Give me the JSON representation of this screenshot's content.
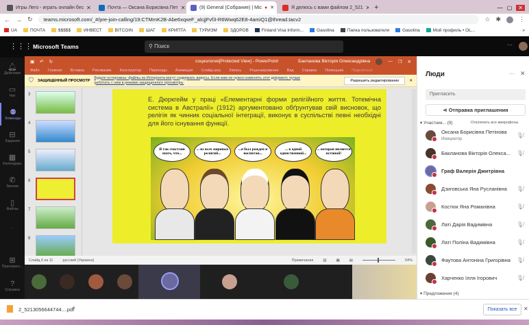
{
  "browser": {
    "tabs": [
      {
        "title": "Игры Лего - играть онлайн бес",
        "color": "#555"
      },
      {
        "title": "Почта — Оксана Борисівна Пет",
        "color": "#0f6cbd"
      },
      {
        "title": "(9) General (Собрание) | Mic",
        "color": "#5b5fc7"
      },
      {
        "title": "Я делюсь с вами файлом 2_521",
        "color": "#d93025"
      }
    ],
    "new_tab": "+",
    "url": "teams.microsoft.com/_#/pre-join-calling/19:CTMmK2B-Abe6xqxeF_alcjjFvf3-R6Wwq62E8-4amiQ1@thread.tacv2",
    "bookmarks": [
      "UA",
      "ПОЧТА",
      "$$$$$",
      "ИНВЕСТ",
      "BITCOIN",
      "ШАГ",
      "КРИПТА",
      "ТУРИЗМ",
      "ЗДОРОВ",
      "Finland Visa Inform...",
      "Gasolina",
      "Папка пользователя",
      "Gasolina",
      "Мой профиль • OL..."
    ],
    "more": "»"
  },
  "teams": {
    "app_name": "Microsoft Teams",
    "search_placeholder": "Поиск",
    "more": "···",
    "rail": [
      {
        "label": "Действия",
        "icon": "bell-icon",
        "badge": "3"
      },
      {
        "label": "Чат",
        "icon": "chat-icon",
        "badge": "6"
      },
      {
        "label": "Команды",
        "icon": "teams-icon",
        "active": true
      },
      {
        "label": "Задания",
        "icon": "assignments-icon"
      },
      {
        "label": "Календарь",
        "icon": "calendar-icon"
      },
      {
        "label": "Звонки",
        "icon": "phone-icon"
      },
      {
        "label": "Файлы",
        "icon": "file-icon"
      },
      {
        "label": "...",
        "icon": "more-icon"
      }
    ],
    "rail_bottom": [
      {
        "label": "Приложен...",
        "icon": "apps-icon"
      },
      {
        "label": "Справка",
        "icon": "help-icon"
      }
    ]
  },
  "ppt": {
    "title": "социология[Protected View] - PowerPoint",
    "user": "Бакланова Вікторія Олександрівна",
    "menu": [
      "Файл",
      "Главная",
      "Вставка",
      "Рисование",
      "Конструктор",
      "Переходы",
      "Анимация",
      "Слайд-шоу",
      "Запись",
      "Рецензирование",
      "Вид",
      "Справка",
      "Помощник",
      "Поделиться"
    ],
    "protected_label": "ЗАЩИЩЕННЫЙ ПРОСМОТР",
    "protected_msg": "Будьте осторожны: файлы из Интернета могут содержать вирусы. Если вам не нужно изменять этот документ, лучше работать с ним в режиме защищенного просмотра.",
    "enable_edit": "Разрешить редактирование",
    "thumb_numbers": [
      "3",
      "4",
      "5",
      "6",
      "7",
      "8"
    ],
    "slide_text": "Е. Дюркгейм у праці «Елементарні форми релігійного життя. Тотемічна система в Австралії» (1912) аргументовано обґрунтував свій висновок, що релігія як чинник соціальної інтеграції, виконує в суспільстві певні необхідні для його існування функції.",
    "bubbles": [
      "Я так счастлив знать, что...",
      "... из всех мировых религий...",
      "...я был рожден и воспитан...",
      "... в одной единственной...",
      "... которая является истиной!"
    ],
    "status": {
      "slide": "Слайд 6 из 11",
      "lang": "русский (Украина)",
      "notes": "Примечания",
      "zoom": "54%"
    }
  },
  "people": {
    "title": "Люди",
    "invite_placeholder": "Пригласить",
    "share_invite": "Отправка приглашения",
    "participants_label": "Участник... (9)",
    "mute_all": "Отключить все микрофоны",
    "participants": [
      {
        "name": "Оксана Борисівна Петінова",
        "role": "Инициатор",
        "color": "#6b4a3a"
      },
      {
        "name": "Бакланова Вікторія Олекса...",
        "color": "#4a3326"
      },
      {
        "name": "Граф Валерія Дмитрівна",
        "bold": true,
        "color": "#6a6aa0"
      },
      {
        "name": "Дзиговська Яна Русланівна",
        "color": "#8a4a30"
      },
      {
        "name": "Костюк Яна Романівна",
        "color": "#c8a090"
      },
      {
        "name": "Латі Дарія Вадимівна",
        "color": "#4a6a3a"
      },
      {
        "name": "Латі Поліна Вадимівна",
        "color": "#3a5a2a"
      },
      {
        "name": "Фаутова Антоніна Григорівна",
        "color": "#3a4a3a"
      },
      {
        "name": "Харченко Ілля Ігорович",
        "color": "#6a4030"
      }
    ],
    "suggestions": "Предложения (4)",
    "show_all": "Показать все"
  },
  "download": {
    "file": "2_5213056644744....pdf"
  }
}
